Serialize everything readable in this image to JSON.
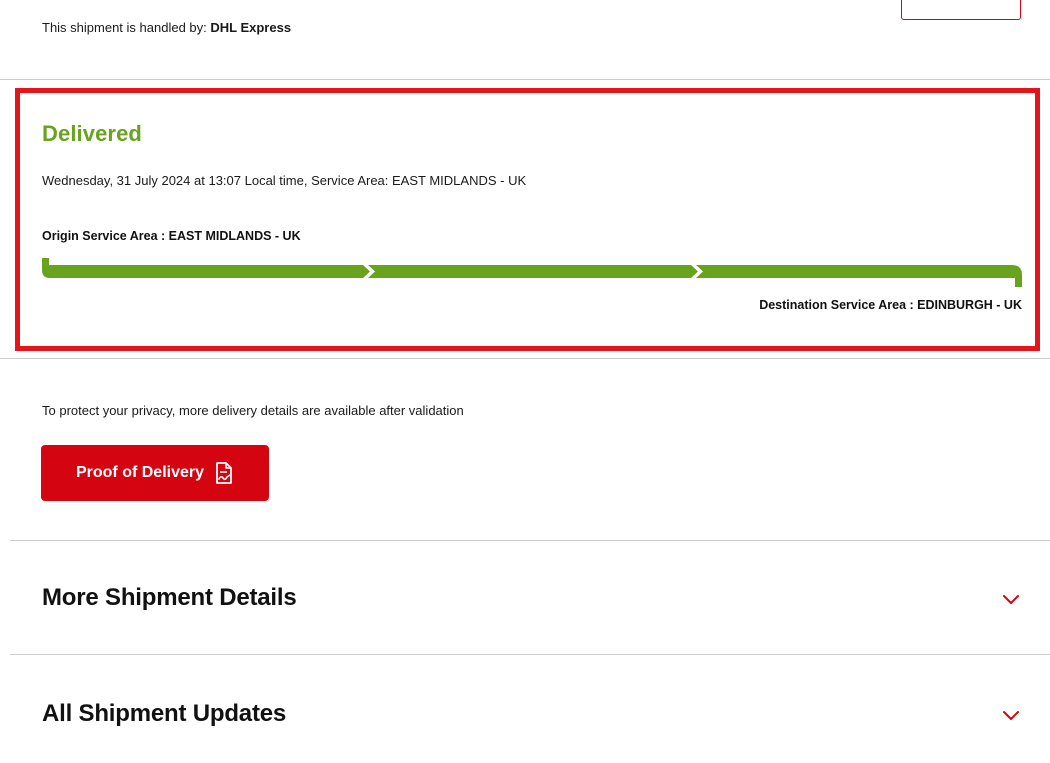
{
  "header": {
    "handled_by_prefix": "This shipment is handled by: ",
    "handled_by_carrier": "DHL Express"
  },
  "status": {
    "title": "Delivered",
    "datetime_line": "Wednesday, 31 July 2024 at 13:07 Local time, Service Area: EAST MIDLANDS - UK",
    "origin_label": "Origin Service Area : EAST MIDLANDS - UK",
    "destination_label": "Destination Service Area : EDINBURGH - UK",
    "progress_fraction": 1.0,
    "progress_color": "#68a31d",
    "highlight_color": "#e5161b"
  },
  "delivery": {
    "privacy_note": "To protect your privacy, more delivery details are available after validation",
    "pod_button_label": "Proof of Delivery",
    "pod_icon": "document-signature-icon",
    "brand_red": "#d40511"
  },
  "accordions": [
    {
      "title": "More Shipment Details",
      "icon": "chevron-down-icon"
    },
    {
      "title": "All Shipment Updates",
      "icon": "chevron-down-icon"
    }
  ]
}
